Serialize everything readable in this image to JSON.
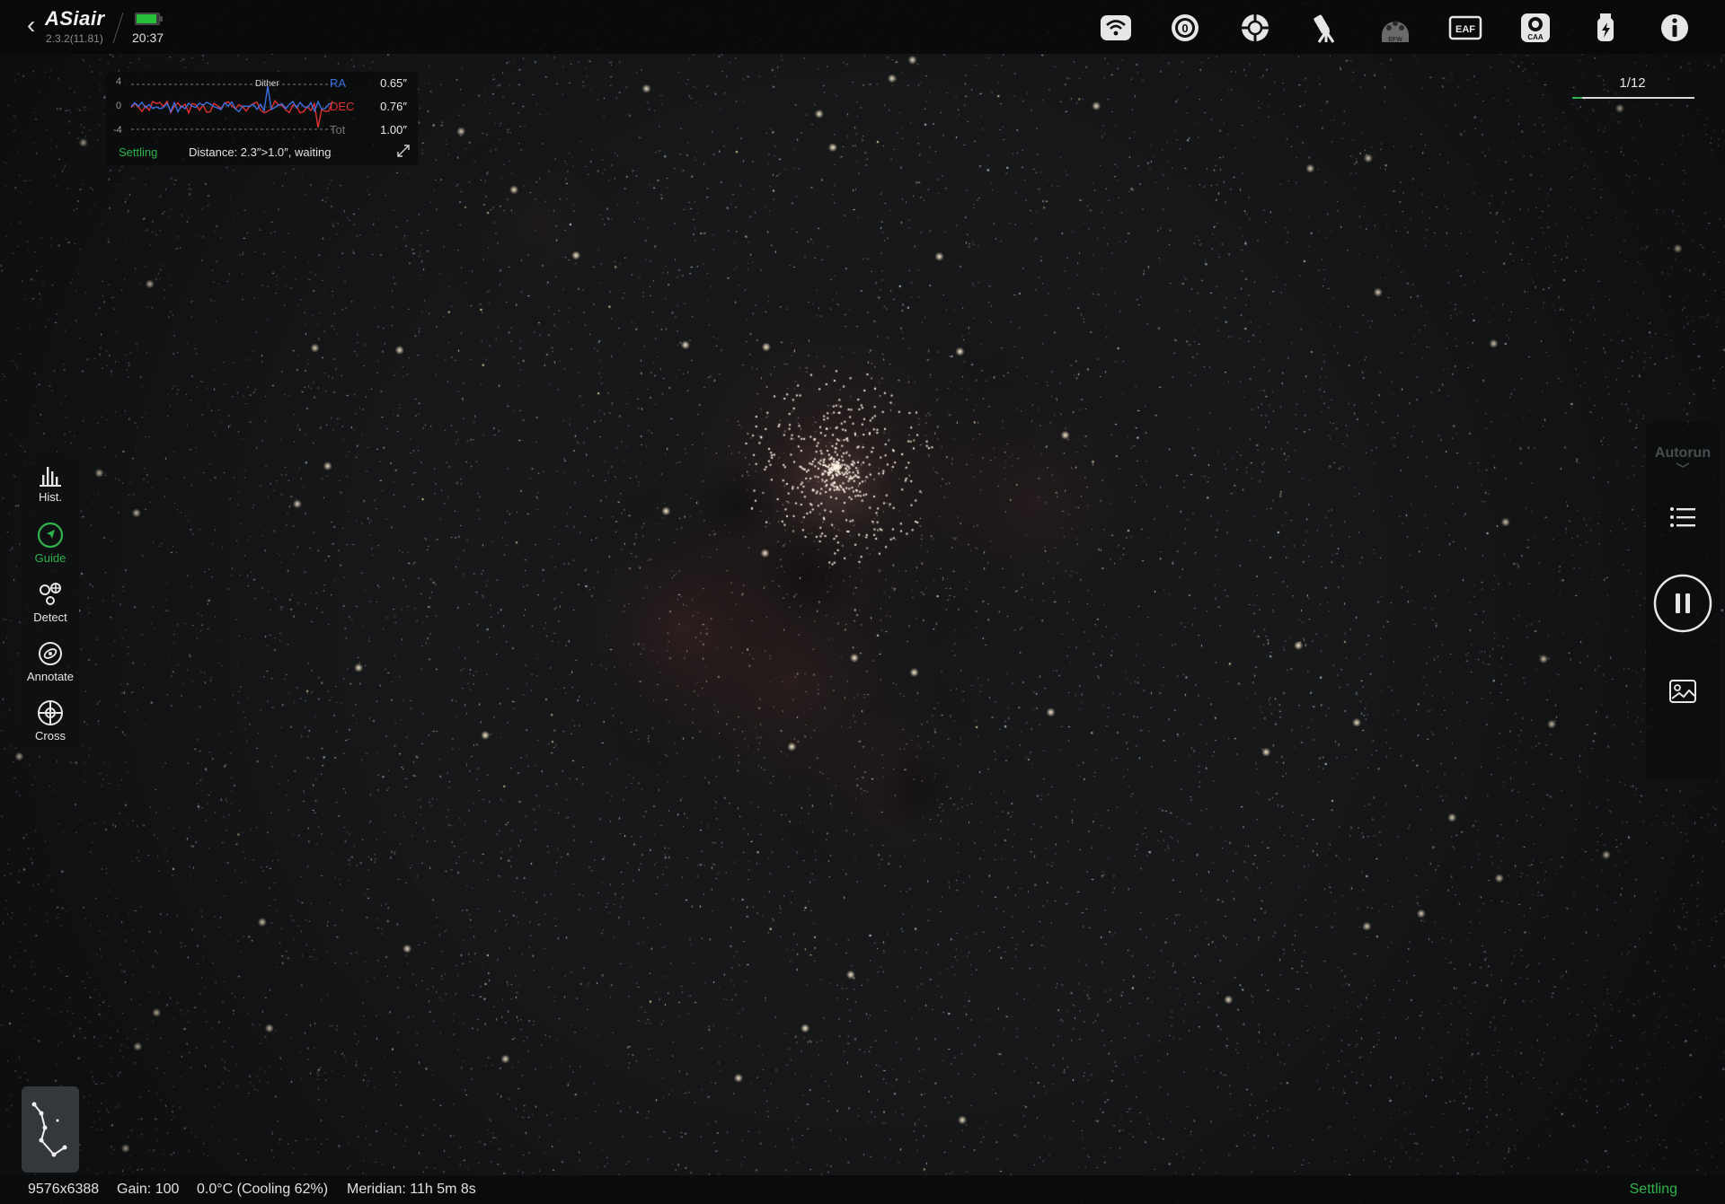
{
  "app": {
    "brand": "ASiair",
    "version": "2.3.2(11.81)",
    "time": "20:37",
    "battery_level": 0.9
  },
  "toolbar_icons": [
    {
      "name": "wifi-icon"
    },
    {
      "name": "camera-icon",
      "label": "0"
    },
    {
      "name": "guide-scope-icon"
    },
    {
      "name": "telescope-mount-icon"
    },
    {
      "name": "filter-wheel-icon",
      "label": "EFW"
    },
    {
      "name": "focuser-icon",
      "label": "EAF"
    },
    {
      "name": "rotator-icon",
      "label": "CAA"
    },
    {
      "name": "power-icon"
    },
    {
      "name": "info-icon"
    }
  ],
  "guide_graph": {
    "y_labels": [
      "4",
      "0",
      "-4"
    ],
    "event_label": "Dither",
    "ra": {
      "label": "RA",
      "value": "0.65″",
      "color": "#3d6fe0"
    },
    "dec": {
      "label": "DEC",
      "value": "0.76″",
      "color": "#e03030"
    },
    "tot": {
      "label": "Tot",
      "value": "1.00″"
    },
    "status": "Settling",
    "message": "Distance: 2.3″>1.0″, waiting"
  },
  "frame_counter": {
    "text": "1/12",
    "progress": 0.0833
  },
  "left_tools": [
    {
      "label": "Hist.",
      "icon": "histogram-icon",
      "active": false
    },
    {
      "label": "Guide",
      "icon": "guide-icon",
      "active": true
    },
    {
      "label": "Detect",
      "icon": "detect-icon",
      "active": false
    },
    {
      "label": "Annotate",
      "icon": "annotate-icon",
      "active": false
    },
    {
      "label": "Cross",
      "icon": "crosshair-icon",
      "active": false
    }
  ],
  "autorun": {
    "title": "Autorun",
    "buttons": [
      "list-icon",
      "pause-icon",
      "image-preview-icon"
    ]
  },
  "status_bar": {
    "resolution": "9576x6388",
    "gain": "Gain: 100",
    "temperature": "0.0°C (Cooling 62%)",
    "meridian": "Meridian: 11h 5m 8s",
    "state": "Settling"
  },
  "colors": {
    "accent_green": "#2fb34a",
    "ra_blue": "#3d6fe0",
    "dec_red": "#e03030"
  }
}
